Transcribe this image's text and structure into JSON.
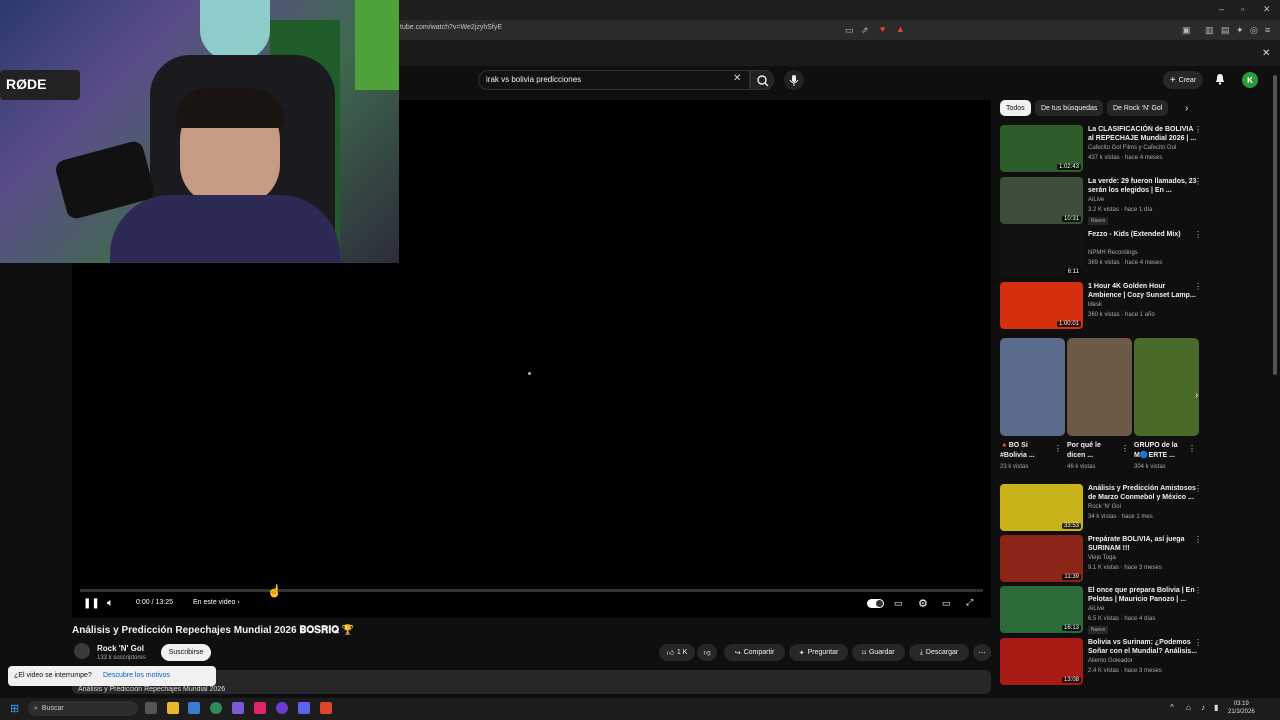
{
  "browser": {
    "url": "tube.com/watch?v=We2jzyhSfyE"
  },
  "header": {
    "search_value": "irak vs bolivia predicciones",
    "create_label": "Crear",
    "avatar_letter": "K"
  },
  "player": {
    "time": "0:00 / 13:25",
    "chapter": "En este video",
    "progress": 0.0
  },
  "video": {
    "title": "Análisis y Predicción Repechajes Mundial 2026 𝐁𝐎𝐒𝐑𝐈𝐐 🏆",
    "channel": "Rock 'N' Gol",
    "subscribers": "133 k suscriptores",
    "subscribe_label": "Suscribirse",
    "likes": "1 K",
    "share_label": "Compartir",
    "ask_label": "Preguntar",
    "save_label": "Guardar",
    "download_label": "Descargar",
    "description_snippet": "Análisis y Predicción Repechajes Mundial 2026"
  },
  "interrupt_toast": {
    "question": "¿El video se interrumpe?",
    "link": "Descubre los motivos"
  },
  "chips": [
    "Todos",
    "De tus búsquedas",
    "De Rock 'N' Gol"
  ],
  "recommendations": [
    {
      "title": "La CLASIFICACIÓN de BOLIVIA al REPECHAJE Mundial 2026 | ...",
      "channel": "Cafecito Gol Films y Cafecito Gol",
      "meta": "437 k vistas · hace 4 meses",
      "duration": "1:02:43",
      "badge": "",
      "color": "#2d5e2a"
    },
    {
      "title": "La verde: 29 fueron llamados, 23 serán los elegidos | En ...",
      "channel": "AiLive",
      "meta": "3.2 K vistas · hace 1 día",
      "duration": "10:31",
      "badge": "Nuevo",
      "color": "#3c4d3a"
    },
    {
      "title": "Fezzo - Kids (Extended Mix)",
      "channel": "NPMH Recordings",
      "meta": "369 k vistas · hace 4 meses",
      "duration": "6:11",
      "badge": "",
      "color": "#111111"
    },
    {
      "title": "1 Hour 4K Golden Hour Ambience | Cozy Sunset Lamp...",
      "channel": "ldesk",
      "meta": "360 k vistas · hace 1 año",
      "duration": "1:00:01",
      "badge": "",
      "color": "#d4300f"
    }
  ],
  "shorts": [
    {
      "title": "🔺BO Si #Bolivia ...",
      "views": "23 k vistas",
      "color": "#5a6b8c"
    },
    {
      "title": "Por qué le dicen ...",
      "views": "46 k vistas",
      "color": "#6b5a48"
    },
    {
      "title": "GRUPO de la M🔵ERTE ...",
      "views": "304 k vistas",
      "color": "#4a6a2a"
    }
  ],
  "recommendations2": [
    {
      "title": "Análisis y Predicción Amistosos de Marzo Conmebol y México ...",
      "channel": "Rock 'N' Gol",
      "meta": "34 k vistas · hace 1 mes",
      "duration": "33:53",
      "badge": "",
      "color": "#c9b21a"
    },
    {
      "title": "Prepárate BOLIVIA, así juega SURINAM !!!",
      "channel": "Viejo Toga",
      "meta": "9.1 K vistas · hace 3 meses",
      "duration": "11:39",
      "badge": "",
      "color": "#8c2418"
    },
    {
      "title": "El once que prepara Bolivia | En Pelotas | Mauricio Panozo | ...",
      "channel": "AiLive",
      "meta": "6.5 K vistas · hace 4 días",
      "duration": "16:13",
      "badge": "Nuevo",
      "color": "#2c6a3a"
    },
    {
      "title": "Bolivia vs Surinam: ¿Podemos Soñar con el Mundial? Análisis...",
      "channel": "Aliento Goleador",
      "meta": "2.4 K vistas · hace 3 meses",
      "duration": "13:08",
      "badge": "",
      "color": "#a81a14"
    }
  ],
  "taskbar": {
    "search_placeholder": "Buscar",
    "time": "03:19",
    "date": "21/3/2026"
  }
}
